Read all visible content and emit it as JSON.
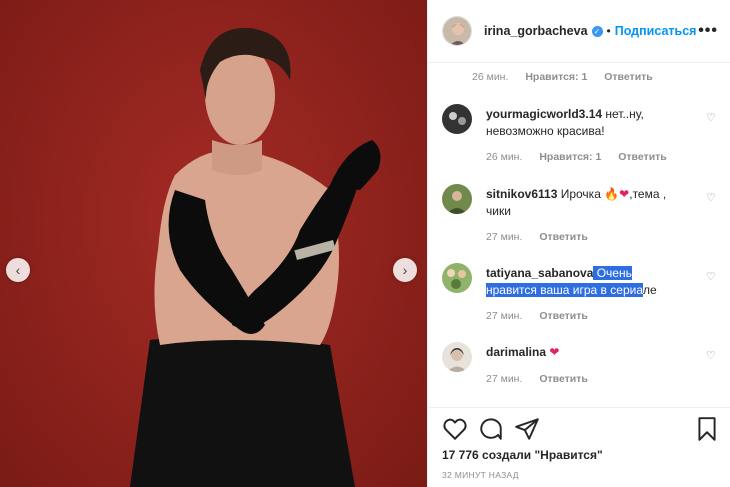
{
  "post": {
    "username": "irina_gorbacheva",
    "follow_label": "Подписаться",
    "dot": "•",
    "more_label": "•••"
  },
  "top_meta": {
    "time": "26 мин.",
    "likes": "Нравится: 1",
    "reply": "Ответить"
  },
  "comments": [
    {
      "user": "yourmagicworld3.14",
      "text": " нет..ну, невозможно красива!",
      "time": "26 мин.",
      "likes": "Нравится: 1",
      "reply": "Ответить"
    },
    {
      "user": "sitnikov6113",
      "text_a": " Ирочка ",
      "text_b": ",тема , чики",
      "time": "27 мин.",
      "reply": "Ответить"
    },
    {
      "user": "tatiyana_sabanova",
      "text_sel": " Очень нравится ваша игра в сериа",
      "text_rest": "ле",
      "time": "27 мин.",
      "reply": "Ответить"
    },
    {
      "user": "darimalina",
      "time": "27 мин.",
      "reply": "Ответить"
    }
  ],
  "likes_count": "17 776 создали \"Нравится\"",
  "posted_time": "32 МИНУТ НАЗАД",
  "icons": [
    "heart-icon",
    "comment-icon",
    "share-icon",
    "bookmark-icon",
    "chevron-left-icon",
    "chevron-right-icon",
    "verified-icon",
    "more-icon",
    "fire-emoji",
    "red-heart-emoji"
  ],
  "colors": {
    "accent": "#0095f6",
    "photo_bg": "#8e221c",
    "selection": "#2f6ee0",
    "heart": "#e0245e"
  }
}
